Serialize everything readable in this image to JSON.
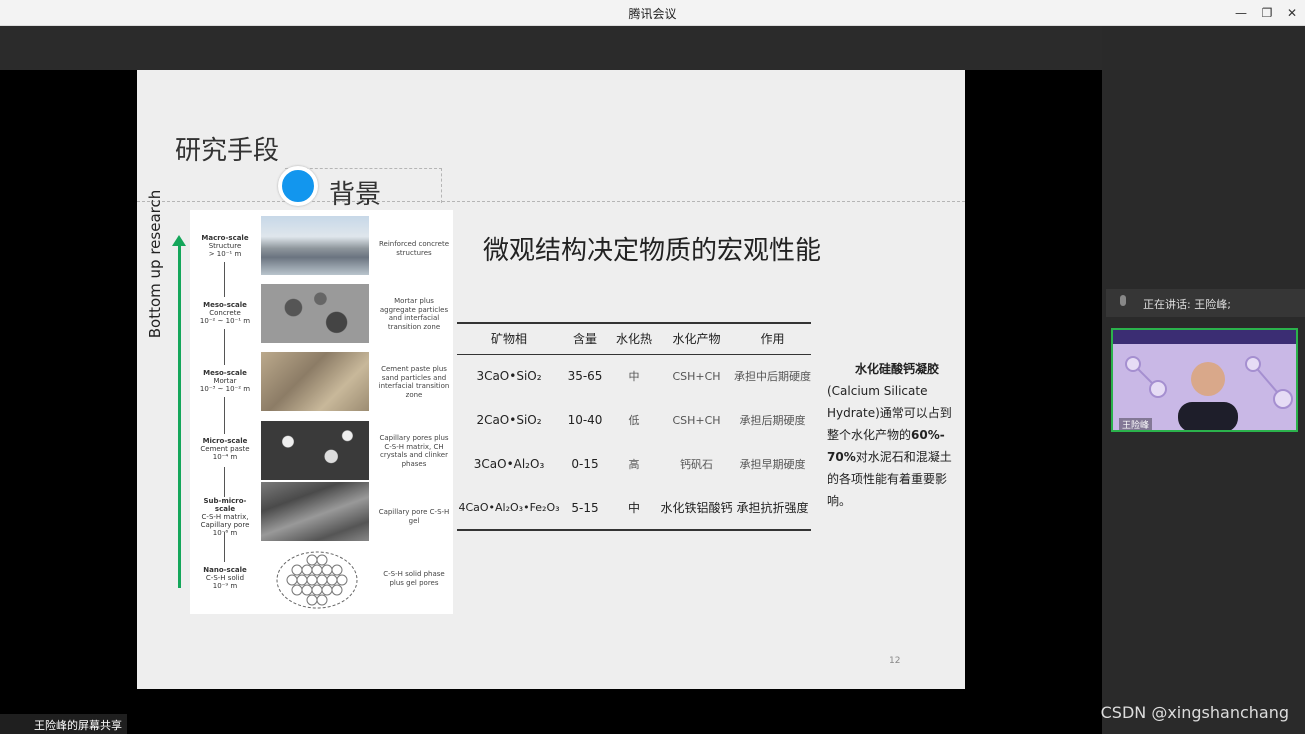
{
  "window": {
    "title": "腾讯会议",
    "minimize": "—",
    "restore": "❐",
    "close": "✕"
  },
  "slide": {
    "title": "研究手段",
    "tab": "背景",
    "headline": "微观结构决定物质的宏观性能",
    "page": "12",
    "figure": {
      "vertical_label": "Bottom up research",
      "scales": [
        {
          "name": "Macro-scale",
          "sub": "Structure",
          "size": "> 10⁻¹ m",
          "desc": "Reinforced concrete structures"
        },
        {
          "name": "Meso-scale",
          "sub": "Concrete",
          "size": "10⁻² ~ 10⁻¹ m",
          "desc": "Mortar plus aggregate particles and interfacial transition zone"
        },
        {
          "name": "Meso-scale",
          "sub": "Mortar",
          "size": "10⁻³ ~ 10⁻² m",
          "desc": "Cement paste plus sand particles and interfacial transition zone"
        },
        {
          "name": "Micro-scale",
          "sub": "Cement paste",
          "size": "10⁻⁴ m",
          "desc": "Capillary pores plus C-S-H matrix, CH crystals and clinker phases"
        },
        {
          "name": "Sub-micro-scale",
          "sub": "C-S-H matrix, Capillary pore",
          "size": "10⁻⁶ m",
          "desc": "Capillary pore C-S-H gel"
        },
        {
          "name": "Nano-scale",
          "sub": "C-S-H solid",
          "size": "10⁻⁹ m",
          "desc": "C-S-H solid phase plus gel pores"
        }
      ]
    },
    "table": {
      "headers": [
        "矿物相",
        "含量",
        "水化热",
        "水化产物",
        "作用"
      ],
      "rows": [
        [
          "3CaO•SiO₂",
          "35-65",
          "中",
          "CSH+CH",
          "承担中后期硬度"
        ],
        [
          "2CaO•SiO₂",
          "10-40",
          "低",
          "CSH+CH",
          "承担后期硬度"
        ],
        [
          "3CaO•Al₂O₃",
          "0-15",
          "高",
          "钙矾石",
          "承担早期硬度"
        ],
        [
          "4CaO•Al₂O₃•Fe₂O₃",
          "5-15",
          "中",
          "水化铁铝酸钙",
          "承担抗折强度"
        ]
      ]
    },
    "note": {
      "heading": "水化硅酸钙凝胶",
      "line1": "(Calcium Silicate",
      "line2": "Hydrate)通常可以占到",
      "line3a": "整个水化产物的",
      "line3b": "60%-",
      "line4a": "70%",
      "line4b": "对水泥石和混凝土",
      "line5": "的各项性能有着重要影响。"
    }
  },
  "sidebar": {
    "speaking": "正在讲话: 王险峰;",
    "video_name": "王险峰"
  },
  "footer": {
    "share_label": "王险峰的屏幕共享",
    "watermark": "CSDN @xingshanchang"
  }
}
